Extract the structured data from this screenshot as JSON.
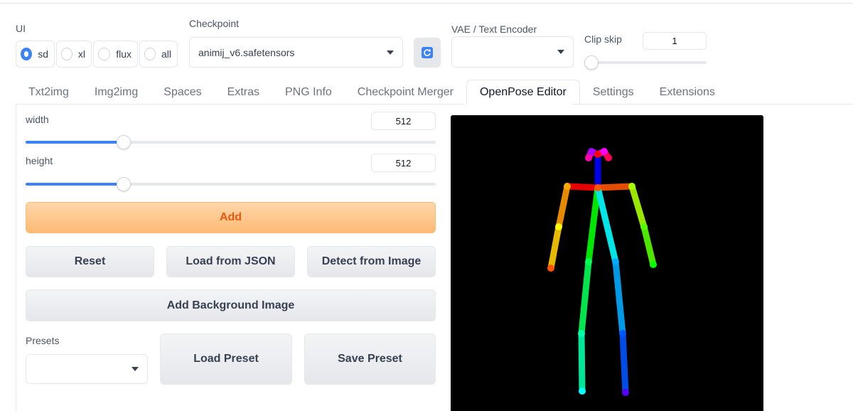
{
  "ui_label": "UI",
  "ui_options": [
    {
      "label": "sd",
      "checked": true
    },
    {
      "label": "xl",
      "checked": false
    },
    {
      "label": "flux",
      "checked": false
    },
    {
      "label": "all",
      "checked": false
    }
  ],
  "checkpoint": {
    "label": "Checkpoint",
    "value": "animij_v6.safetensors"
  },
  "vae": {
    "label": "VAE / Text Encoder",
    "value": ""
  },
  "clip_skip": {
    "label": "Clip skip",
    "value": "1"
  },
  "tabs": [
    {
      "label": "Txt2img",
      "active": false
    },
    {
      "label": "Img2img",
      "active": false
    },
    {
      "label": "Spaces",
      "active": false
    },
    {
      "label": "Extras",
      "active": false
    },
    {
      "label": "PNG Info",
      "active": false
    },
    {
      "label": "Checkpoint Merger",
      "active": false
    },
    {
      "label": "OpenPose Editor",
      "active": true
    },
    {
      "label": "Settings",
      "active": false
    },
    {
      "label": "Extensions",
      "active": false
    }
  ],
  "width": {
    "label": "width",
    "value": "512",
    "fraction": 0.24
  },
  "height": {
    "label": "height",
    "value": "512",
    "fraction": 0.24
  },
  "buttons": {
    "add": "Add",
    "reset": "Reset",
    "load_json": "Load from JSON",
    "detect": "Detect from Image",
    "add_background": "Add Background Image",
    "load_preset": "Load Preset",
    "save_preset": "Save Preset"
  },
  "presets": {
    "label": "Presets",
    "value": ""
  },
  "colors": {
    "accent": "#3b82f6",
    "primary_btn": "#fdba74",
    "primary_text": "#ea580c"
  }
}
